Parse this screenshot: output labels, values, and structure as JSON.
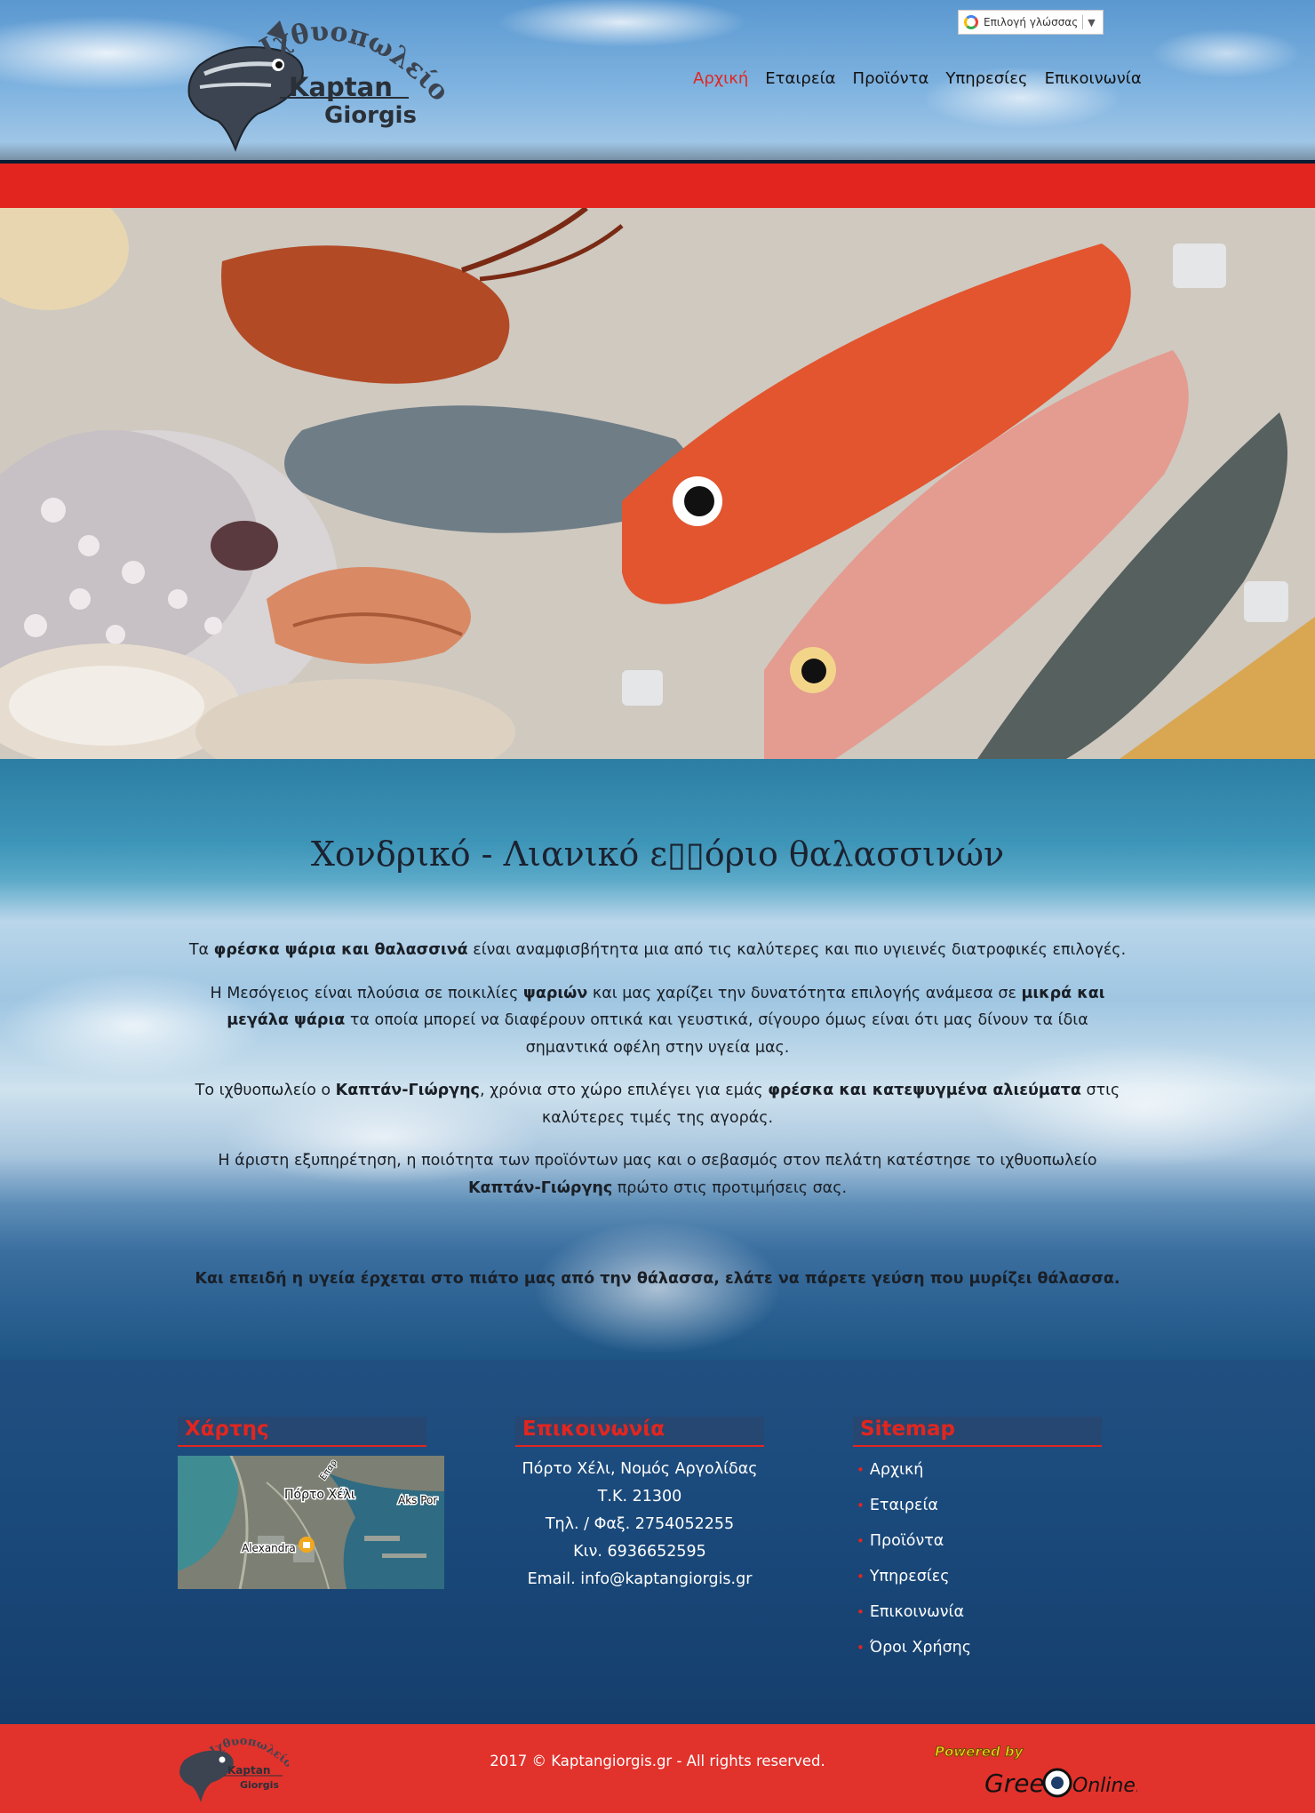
{
  "header": {
    "logo": {
      "greek_text": "Ιχθυοπωλείο",
      "name_line1": "Kaptan",
      "name_line2": "Giorgis"
    },
    "language_selector": {
      "label": "Επιλογή γλώσσας",
      "arrow": "▼"
    },
    "nav": [
      {
        "label": "Αρχική",
        "active": true
      },
      {
        "label": "Εταιρεία",
        "active": false
      },
      {
        "label": "Προϊόντα",
        "active": false
      },
      {
        "label": "Υπηρεσίες",
        "active": false
      },
      {
        "label": "Επικοινωνία",
        "active": false
      }
    ]
  },
  "main": {
    "title": "Χονδρικό - Λιανικό ε▯▯όριο θαλασσινών",
    "paragraphs": [
      {
        "parts": [
          {
            "t": "Τα ",
            "b": false
          },
          {
            "t": "φρέσκα ψάρια και θαλασσινά",
            "b": true
          },
          {
            "t": " είναι αναμφισβήτητα μια από τις καλύτερες και πιο υγιεινές διατροφικές επιλογές.",
            "b": false
          }
        ]
      },
      {
        "parts": [
          {
            "t": "Η Μεσόγειος είναι πλούσια σε ποικιλίες ",
            "b": false
          },
          {
            "t": "ψαριών",
            "b": true
          },
          {
            "t": " και μας χαρίζει την δυνατότητα επιλογής ανάμεσα σε ",
            "b": false
          },
          {
            "t": "μικρά και μεγάλα ψάρια",
            "b": true
          },
          {
            "t": " τα οποία μπορεί να διαφέρουν οπτικά και γευστικά, σίγουρο όμως είναι ότι μας δίνουν τα ίδια σημαντικά οφέλη στην υγεία μας.",
            "b": false
          }
        ]
      },
      {
        "parts": [
          {
            "t": "Το ιχθυοπωλείο  ο ",
            "b": false
          },
          {
            "t": "Καπτάν-Γιώργης",
            "b": true
          },
          {
            "t": ", χρόνια στο χώρο επιλέγει για εμάς ",
            "b": false
          },
          {
            "t": "φρέσκα και κατεψυγμένα αλιεύματα",
            "b": true
          },
          {
            "t": " στις καλύτερες τιμές της αγοράς.",
            "b": false
          }
        ]
      },
      {
        "parts": [
          {
            "t": "Η άριστη εξυπηρέτηση, η ποιότητα των προϊόντων μας και ο σεβασμός στον πελάτη κατέστησε το ιχθυοπωλείο ",
            "b": false
          },
          {
            "t": "Καπτάν-Γιώργης",
            "b": true
          },
          {
            "t": " πρώτο στις προτιμήσεις σας.",
            "b": false
          }
        ]
      }
    ],
    "closing": "Και επειδή η υγεία έρχεται στο πιάτο μας από την θάλασσα, ελάτε να πάρετε γεύση που μυρίζει θάλασσα."
  },
  "footer": {
    "map": {
      "heading": "Χάρτης",
      "labels": {
        "town": "Πόρτο Χέλι",
        "place": "Alexandra",
        "street": "Aks Por",
        "road": "Επαρ"
      }
    },
    "contact": {
      "heading": "Επικοινωνία",
      "lines": [
        "Πόρτο Χέλι, Νομός Αργολίδας",
        "Τ.Κ. 21300",
        "Τηλ. / Φαξ. 2754052255",
        "Κιν. 6936652595",
        "Email. info@kaptangiorgis.gr"
      ]
    },
    "sitemap": {
      "heading": "Sitemap",
      "items": [
        "Αρχική",
        "Εταιρεία",
        "Προϊόντα",
        "Υπηρεσίες",
        "Επικοινωνία",
        "Όροι Χρήσης"
      ]
    },
    "copyright": "2017 © Kaptangiorgis.gr - All rights reserved.",
    "powered_by": {
      "line1": "Powered by",
      "line2a": "Greek",
      "line2b": "Online.gr"
    }
  },
  "colors": {
    "accent": "#e2261f",
    "footer_bg": "#1a4a7c",
    "text_dark": "#1a1f26"
  },
  "icons": [
    "google-translate-icon",
    "fish-logo-icon",
    "bullet-dot-icon",
    "map-pin-icon",
    "eye-icon"
  ]
}
